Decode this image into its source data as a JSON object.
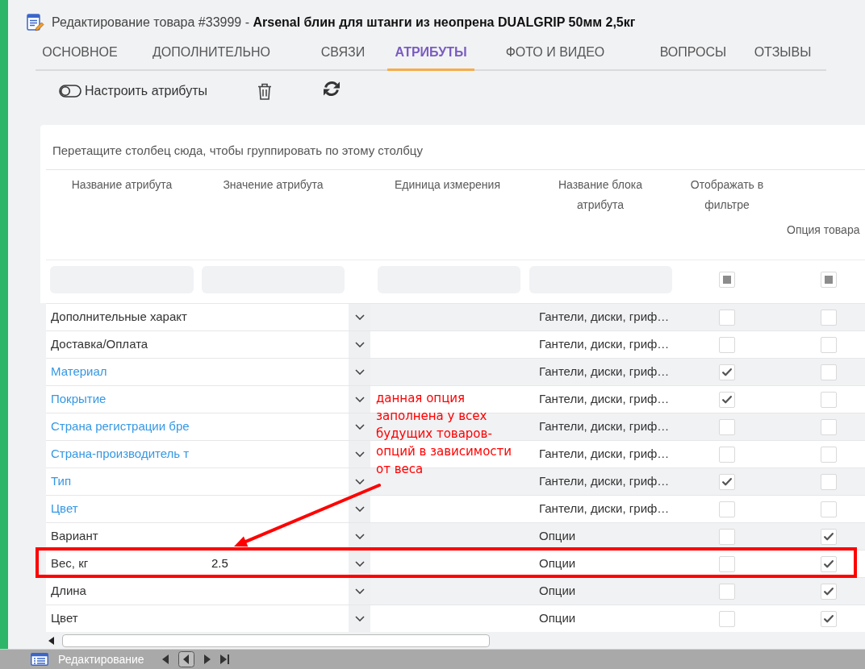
{
  "window": {
    "title": "Редактирование товара #33999 - **Arsenal блин для штанги из неопрена DUALGRIP 50мм 2,5кг**"
  },
  "tabs": [
    {
      "label": "ОСНОВНОЕ",
      "selected": false
    },
    {
      "label": "ДОПОЛНИТЕЛЬНО",
      "selected": false
    },
    {
      "label": "СВЯЗИ",
      "selected": false
    },
    {
      "label": "АТРИБУТЫ",
      "selected": true
    },
    {
      "label": "ФОТО И ВИДЕО",
      "selected": false
    },
    {
      "label": "ВОПРОСЫ",
      "selected": false
    },
    {
      "label": "ОТЗЫВЫ",
      "selected": false
    }
  ],
  "toolbar": [
    {
      "kind": "toggle",
      "label": "Настроить атрибуты"
    },
    {
      "kind": "delete"
    },
    {
      "kind": "refresh"
    }
  ],
  "grid": {
    "group_hint": "Перетащите столбец сюда, чтобы группировать по этому столбцу",
    "columns": [
      {
        "label": "Название атрибута",
        "kind": "text"
      },
      {
        "label": "Значение атрибута",
        "kind": "text"
      },
      {
        "label": "Единица измерения",
        "kind": "text"
      },
      {
        "label": "Название блока атрибута",
        "kind": "text"
      },
      {
        "label": "Отображать в фильтре",
        "kind": "check",
        "filter_indeterminate": true
      },
      {
        "label": "Опция товара",
        "kind": "check",
        "filter_indeterminate": true
      }
    ],
    "rows": [
      {
        "name": "Дополнительные характ",
        "linked": false,
        "block": "Гантели, диски, гриф…",
        "filter": false,
        "option": false,
        "highlighted": false
      },
      {
        "name": "Доставка/Оплата",
        "linked": false,
        "block": "Гантели, диски, гриф…",
        "filter": false,
        "option": false,
        "highlighted": false
      },
      {
        "name": "Материал",
        "linked": true,
        "block": "Гантели, диски, гриф…",
        "filter": true,
        "option": false,
        "highlighted": false
      },
      {
        "name": "Покрытие",
        "linked": true,
        "block": "Гантели, диски, гриф…",
        "filter": true,
        "option": false,
        "highlighted": false
      },
      {
        "name": "Страна регистрации бре",
        "linked": true,
        "block": "Гантели, диски, гриф…",
        "filter": false,
        "option": false,
        "highlighted": false
      },
      {
        "name": "Страна-производитель т",
        "linked": true,
        "block": "Гантели, диски, гриф…",
        "filter": false,
        "option": false,
        "highlighted": false
      },
      {
        "name": "Тип",
        "linked": true,
        "block": "Гантели, диски, гриф…",
        "filter": true,
        "option": false,
        "highlighted": false
      },
      {
        "name": "Цвет",
        "linked": true,
        "block": "Гантели, диски, гриф…",
        "filter": false,
        "option": false,
        "highlighted": false
      },
      {
        "name": "Вариант",
        "linked": false,
        "block": "Опции",
        "filter": false,
        "option": true,
        "highlighted": false
      },
      {
        "name": "Вес, кг",
        "linked": false,
        "value": "2.5",
        "block": "Опции",
        "filter": false,
        "option": true,
        "highlighted": true
      },
      {
        "name": "Длина",
        "linked": false,
        "block": "Опции",
        "filter": false,
        "option": true,
        "highlighted": false
      },
      {
        "name": "Цвет",
        "linked": false,
        "block": "Опции",
        "filter": false,
        "option": true,
        "highlighted": false
      }
    ]
  },
  "annotation": {
    "text": "данная опция заполнена у всех\n будущих товаров-опций\nв зависимости от веса"
  },
  "taskbar": {
    "label": "Редактирование"
  }
}
